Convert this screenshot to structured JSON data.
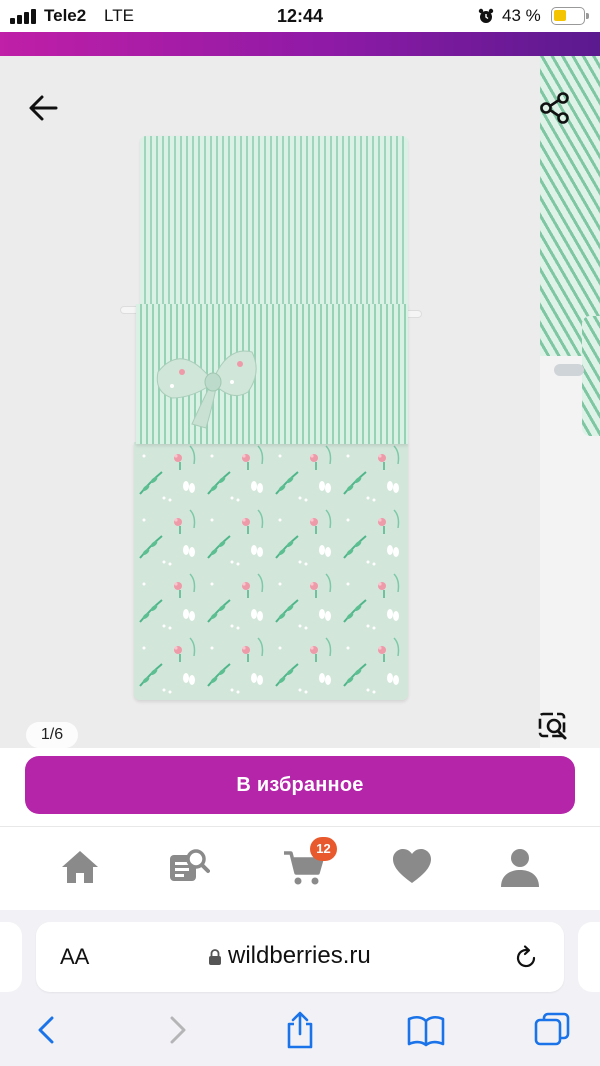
{
  "status_bar": {
    "carrier": "Tele2",
    "network": "LTE",
    "time": "12:44",
    "battery_percent_label": "43 %",
    "battery_level": 0.43,
    "icons": [
      "signal-icon",
      "alarm-icon",
      "battery-icon"
    ]
  },
  "colors": {
    "brand_gradient_start": "#c01fa7",
    "brand_gradient_end": "#5b1a8f",
    "favorite_button": "#b425a9",
    "badge": "#e85a2e",
    "ios_blue": "#1a73e8",
    "nav_icon_gray": "#8a8a8a"
  },
  "gallery": {
    "counter": "1/6",
    "icons": [
      "back-arrow-icon",
      "share-icon",
      "image-search-icon"
    ]
  },
  "favorite": {
    "label": "В избранное"
  },
  "bottom_nav": {
    "items": [
      {
        "name": "home",
        "icon": "home-icon"
      },
      {
        "name": "catalog",
        "icon": "catalog-search-icon"
      },
      {
        "name": "cart",
        "icon": "cart-icon",
        "badge": "12"
      },
      {
        "name": "favorites",
        "icon": "heart-icon"
      },
      {
        "name": "profile",
        "icon": "profile-icon"
      }
    ]
  },
  "safari": {
    "text_size_label": "AA",
    "url": "wildberries.ru",
    "toolbar": [
      "back-icon",
      "forward-icon",
      "share-icon",
      "bookmarks-icon",
      "tabs-icon"
    ]
  }
}
